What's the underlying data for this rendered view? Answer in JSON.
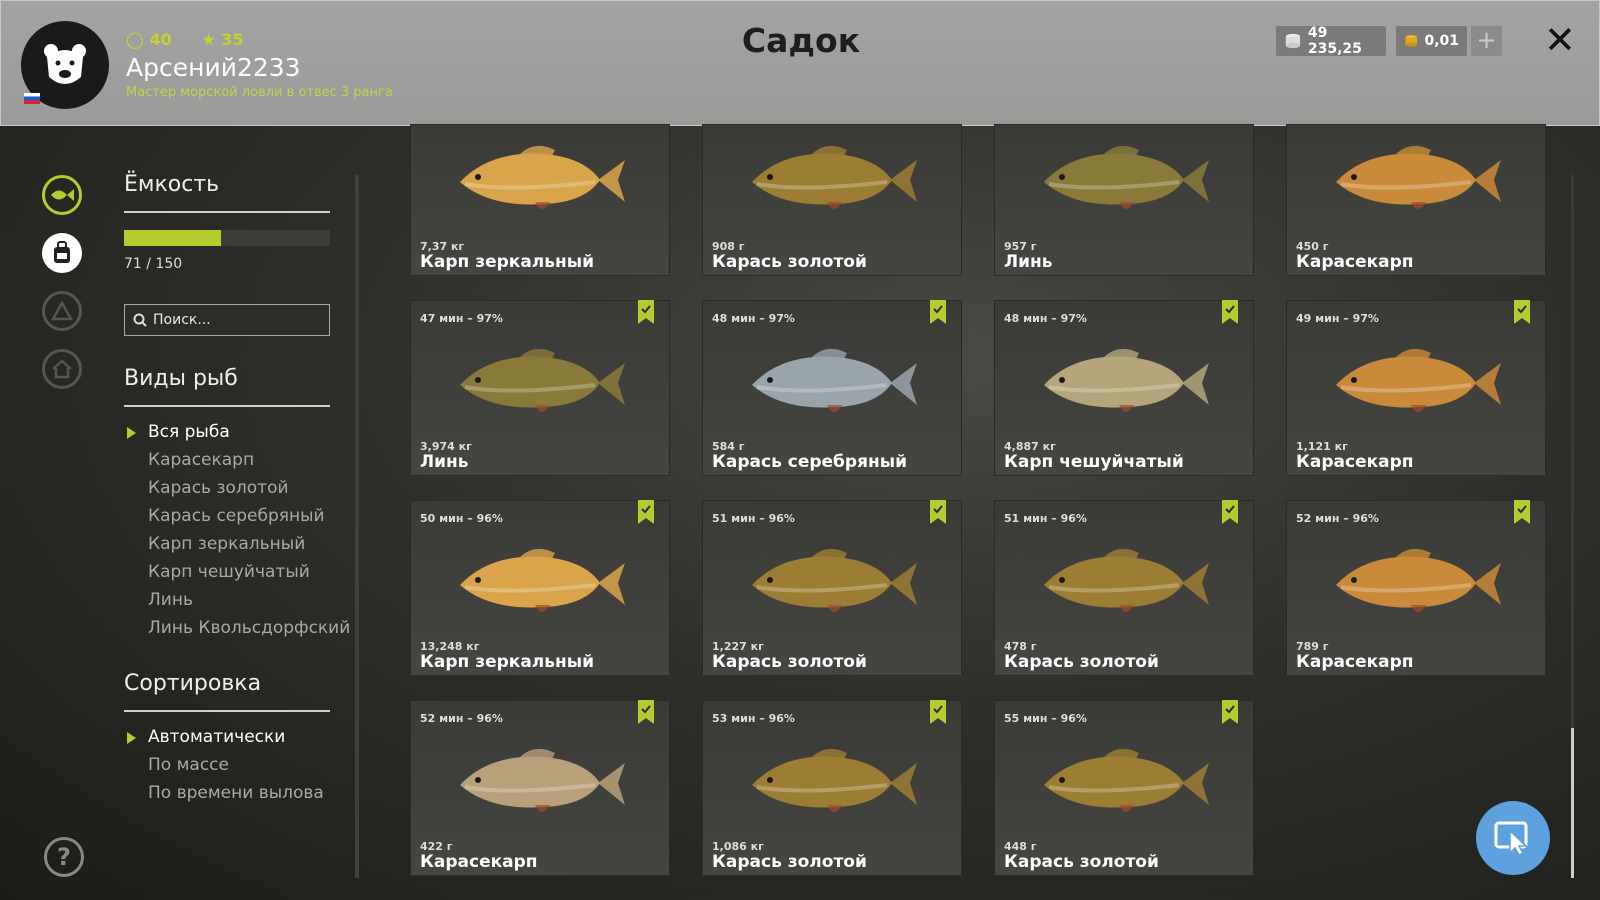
{
  "header": {
    "title": "Садок",
    "username": "Арсений2233",
    "rank_text": "Мастер морской ловли в отвес 3 ранга",
    "level": "40",
    "stars": "35",
    "silver": "49 235,25",
    "gold": "0,01",
    "plus_label": "+",
    "close_label": "✕"
  },
  "sidebar": {
    "capacity_title": "Ёмкость",
    "capacity_text": "71 / 150",
    "capacity_fraction": 0.473,
    "search_placeholder": "Поиск...",
    "species_title": "Виды рыб",
    "species": [
      "Вся рыба",
      "Карасекарп",
      "Карась золотой",
      "Карась серебряный",
      "Карп зеркальный",
      "Карп чешуйчатый",
      "Линь",
      "Линь Квольсдорфский"
    ],
    "sort_title": "Сортировка",
    "sort_options": [
      "Автоматически",
      "По массе",
      "По времени вылова"
    ],
    "help_label": "?"
  },
  "cards": [
    {
      "time": "",
      "weight": "7,37 кг",
      "name": "Карп зеркальный",
      "fish": "mirror-carp",
      "bookmark": false
    },
    {
      "time": "",
      "weight": "908 г",
      "name": "Карась золотой",
      "fish": "golden-crucian",
      "bookmark": false
    },
    {
      "time": "",
      "weight": "957 г",
      "name": "Линь",
      "fish": "tench",
      "bookmark": false
    },
    {
      "time": "",
      "weight": "450 г",
      "name": "Карасекарп",
      "fish": "crucian-carp",
      "bookmark": false
    },
    {
      "time": "47 мин – 97%",
      "weight": "3,974 кг",
      "name": "Линь",
      "fish": "tench",
      "bookmark": true
    },
    {
      "time": "48 мин – 97%",
      "weight": "584 г",
      "name": "Карась серебряный",
      "fish": "silver-crucian",
      "bookmark": true
    },
    {
      "time": "48 мин – 97%",
      "weight": "4,887 кг",
      "name": "Карп чешуйчатый",
      "fish": "common-carp",
      "bookmark": true
    },
    {
      "time": "49 мин – 97%",
      "weight": "1,121 кг",
      "name": "Карасекарп",
      "fish": "crucian-carp",
      "bookmark": true
    },
    {
      "time": "50 мин – 96%",
      "weight": "13,248 кг",
      "name": "Карп зеркальный",
      "fish": "mirror-carp",
      "bookmark": true
    },
    {
      "time": "51 мин – 96%",
      "weight": "1,227 кг",
      "name": "Карась золотой",
      "fish": "golden-crucian",
      "bookmark": true
    },
    {
      "time": "51 мин – 96%",
      "weight": "478 г",
      "name": "Карась золотой",
      "fish": "golden-crucian",
      "bookmark": true
    },
    {
      "time": "52 мин – 96%",
      "weight": "789 г",
      "name": "Карасекарп",
      "fish": "crucian-carp",
      "bookmark": true
    },
    {
      "time": "52 мин – 96%",
      "weight": "422 г",
      "name": "Карасекарп",
      "fish": "crucian-carp-pale",
      "bookmark": true
    },
    {
      "time": "53 мин – 96%",
      "weight": "1,086 кг",
      "name": "Карась золотой",
      "fish": "golden-crucian",
      "bookmark": true
    },
    {
      "time": "55 мин – 96%",
      "weight": "448 г",
      "name": "Карась золотой",
      "fish": "golden-crucian",
      "bookmark": true
    }
  ],
  "colors": {
    "accent": "#b6cc2e",
    "header_bg": "#9fa09e",
    "fab": "#5da2de",
    "fish": {
      "mirror-carp": "#d9a44a",
      "golden-crucian": "#9c7d34",
      "tench": "#8a7a3a",
      "crucian-carp": "#c98a3a",
      "crucian-carp-pale": "#b8a07a",
      "silver-crucian": "#9aa4ab",
      "common-carp": "#b5a57a"
    }
  }
}
